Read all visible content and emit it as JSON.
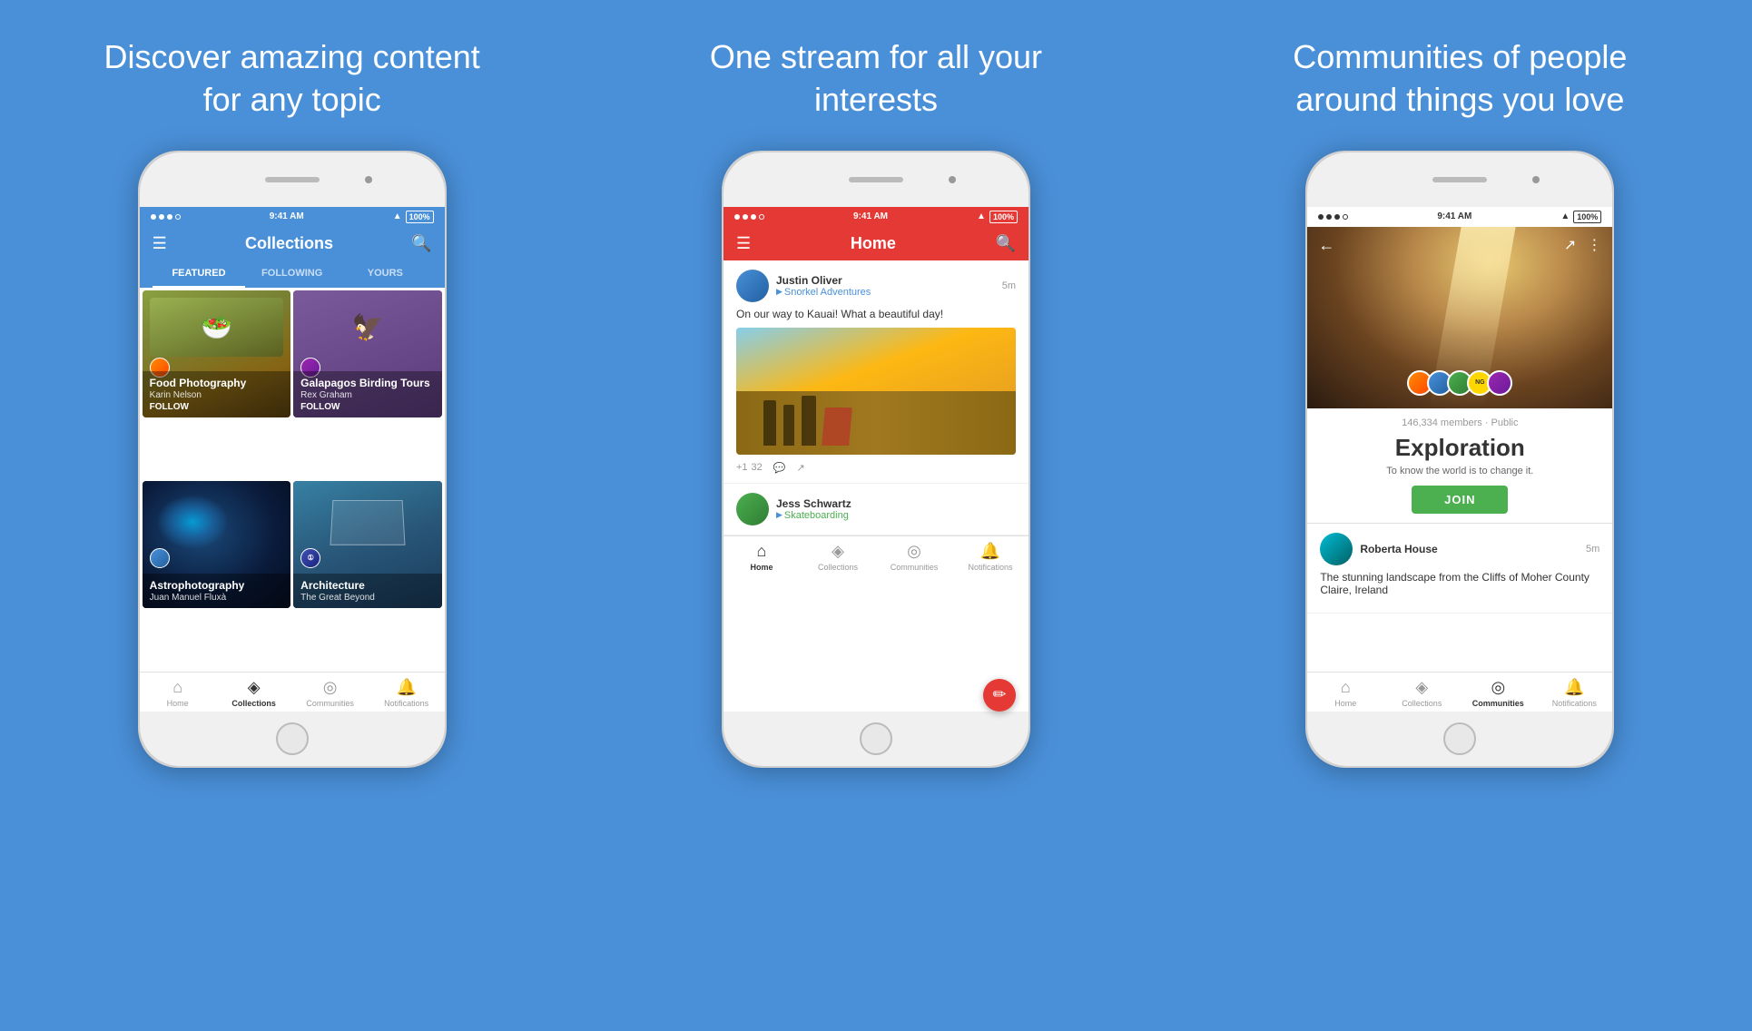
{
  "panels": [
    {
      "id": "panel1",
      "title": "Discover amazing content for any topic",
      "phone": {
        "statusBar": {
          "dots": 4,
          "time": "9:41 AM",
          "battery": "100%",
          "wifi": true,
          "theme": "dark"
        },
        "header": {
          "title": "Collections",
          "theme": "blue",
          "leftIcon": "☰",
          "rightIcon": "🔍"
        },
        "tabs": [
          "FEATURED",
          "FOLLOWING",
          "YOURS"
        ],
        "activeTab": 0,
        "collections": [
          {
            "title": "Food Photography",
            "author": "Karin Nelson",
            "follow": "FOLLOW",
            "theme": "food"
          },
          {
            "title": "Galapagos Birding Tours",
            "author": "Rex Graham",
            "follow": "FOLLOW",
            "theme": "galapagos"
          },
          {
            "title": "Astrophotography",
            "author": "Juan Manuel Fluxà",
            "follow": "",
            "theme": "astro"
          },
          {
            "title": "Architecture",
            "author": "The Great Beyond",
            "follow": "",
            "theme": "arch"
          }
        ],
        "nav": [
          {
            "icon": "⌂",
            "label": "Home",
            "active": false
          },
          {
            "icon": "◈",
            "label": "Collections",
            "active": true
          },
          {
            "icon": "◎",
            "label": "Communities",
            "active": false
          },
          {
            "icon": "🔔",
            "label": "Notifications",
            "active": false
          }
        ]
      }
    },
    {
      "id": "panel2",
      "title": "One stream for all your interests",
      "phone": {
        "statusBar": {
          "time": "9:41 AM",
          "battery": "100%",
          "theme": "red"
        },
        "header": {
          "title": "Home",
          "theme": "red",
          "leftIcon": "☰",
          "rightIcon": "🔍"
        },
        "posts": [
          {
            "avatar": "av-blue",
            "username": "Justin Oliver",
            "community": "Snorkel Adventures",
            "time": "5m",
            "text": "On our way to Kauai! What a beautiful day!",
            "hasImage": true,
            "plusOne": "+1",
            "count": "32"
          }
        ],
        "nextPostPreview": {
          "avatar": "av-green",
          "username": "Jess Schwartz",
          "community": "Skateboarding"
        },
        "nav": [
          {
            "icon": "⌂",
            "label": "Home",
            "active": true
          },
          {
            "icon": "◈",
            "label": "Collections",
            "active": false
          },
          {
            "icon": "◎",
            "label": "Communities",
            "active": false
          },
          {
            "icon": "🔔",
            "label": "Notifications",
            "active": false
          }
        ]
      }
    },
    {
      "id": "panel3",
      "title": "Communities of people around things you love",
      "phone": {
        "statusBar": {
          "time": "9:41 AM",
          "battery": "100%",
          "theme": "white"
        },
        "header": {
          "leftIcon": "←",
          "rightIcon": "↗",
          "moreIcon": "⋮",
          "theme": "transparent"
        },
        "community": {
          "membersCount": "146,334 members · Public",
          "name": "Exploration",
          "description": "To know the world is to change it.",
          "joinLabel": "JOIN"
        },
        "post": {
          "avatar": "av-teal",
          "username": "Roberta House",
          "time": "5m",
          "text": "The stunning landscape from the Cliffs of Moher County Claire, Ireland"
        },
        "nav": [
          {
            "icon": "⌂",
            "label": "Home",
            "active": false
          },
          {
            "icon": "◈",
            "label": "Collections",
            "active": false
          },
          {
            "icon": "◎",
            "label": "Communities",
            "active": true
          },
          {
            "icon": "🔔",
            "label": "Notifications",
            "active": false
          }
        ]
      }
    }
  ]
}
